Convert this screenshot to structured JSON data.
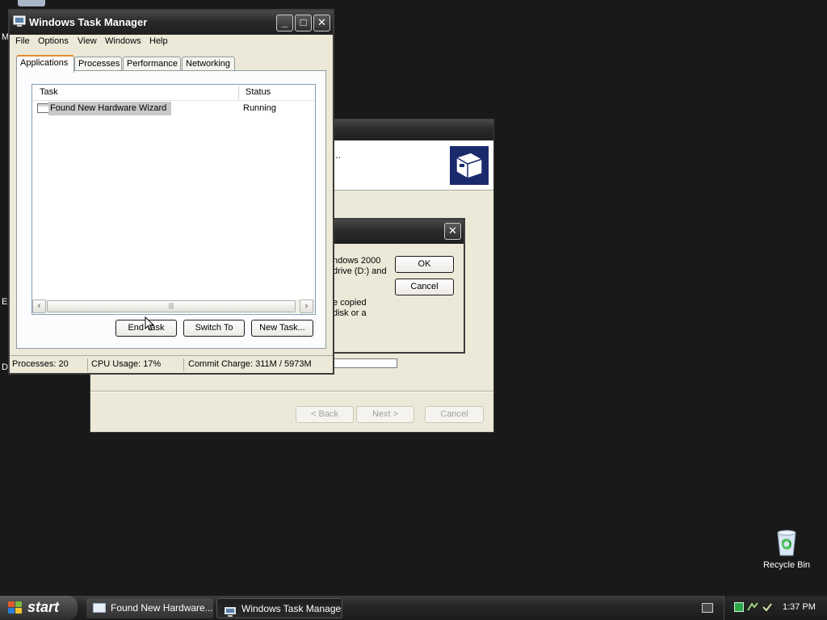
{
  "desktop": {
    "left_letters": [
      "M",
      "E",
      "D"
    ],
    "recycle_bin_label": "Recycle Bin"
  },
  "wizard": {
    "header_text": "...",
    "buttons": {
      "back": "< Back",
      "next": "Next >",
      "cancel": "Cancel"
    }
  },
  "dialog": {
    "message_lines_1": [
      "ndows 2000",
      "drive (D:) and"
    ],
    "message_lines_2": [
      "e copied",
      "disk or a"
    ],
    "ok_label": "OK",
    "cancel_label": "Cancel"
  },
  "taskmgr": {
    "title": "Windows Task Manager",
    "menu": [
      "File",
      "Options",
      "View",
      "Windows",
      "Help"
    ],
    "tabs": [
      "Applications",
      "Processes",
      "Performance",
      "Networking"
    ],
    "active_tab": "Applications",
    "columns": {
      "task": "Task",
      "status": "Status"
    },
    "rows": [
      {
        "task": "Found New Hardware Wizard",
        "status": "Running"
      }
    ],
    "buttons": {
      "end_task": "End Task",
      "switch_to": "Switch To",
      "new_task": "New Task..."
    },
    "statusbar": {
      "processes": "Processes: 20",
      "cpu": "CPU Usage: 17%",
      "commit": "Commit Charge: 311M / 5973M"
    }
  },
  "taskbar": {
    "start_label": "start",
    "buttons": [
      {
        "label": "Found New Hardware..."
      },
      {
        "label": "Windows Task Manager"
      }
    ],
    "clock": "1:37 PM"
  },
  "colors": {
    "desktop": "#191919",
    "window_face": "#ece9d8",
    "titlebar": "#2a2a2a",
    "tab_highlight": "#e68b2c"
  }
}
